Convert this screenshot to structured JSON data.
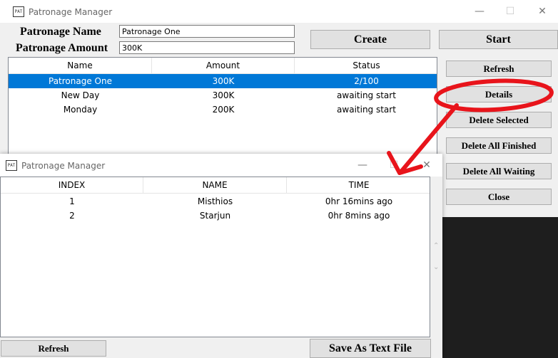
{
  "colors": {
    "accent": "#0078d7",
    "annotation": "#e8141b"
  },
  "main_window": {
    "icon_label": "PAT",
    "title": "Patronage Manager",
    "controls": {
      "minimize": "—",
      "maximize": "☐",
      "close": "✕"
    },
    "form": {
      "name_label": "Patronage Name",
      "name_value": "Patronage One",
      "amount_label": "Patronage Amount",
      "amount_value": "300K"
    },
    "create_label": "Create",
    "start_label": "Start",
    "table": {
      "columns": [
        "Name",
        "Amount",
        "Status"
      ],
      "rows": [
        {
          "name": "Patronage One",
          "amount": "300K",
          "status": "2/100"
        },
        {
          "name": "New Day",
          "amount": "300K",
          "status": "awaiting start"
        },
        {
          "name": "Monday",
          "amount": "200K",
          "status": "awaiting start"
        }
      ]
    },
    "side_buttons": {
      "refresh": "Refresh",
      "details": "Details",
      "delete_selected": "Delete Selected",
      "delete_all_finished": "Delete All Finished",
      "delete_all_waiting": "Delete All Waiting",
      "close": "Close"
    }
  },
  "details_window": {
    "icon_label": "PAT",
    "title": "Patronage Manager",
    "controls": {
      "minimize": "—",
      "maximize": "☐",
      "close": "✕"
    },
    "table": {
      "columns": [
        "INDEX",
        "NAME",
        "TIME"
      ],
      "rows": [
        {
          "index": "1",
          "name": "Misthios",
          "time": "0hr 16mins ago"
        },
        {
          "index": "2",
          "name": "Starjun",
          "time": "0hr 8mins ago"
        }
      ]
    },
    "scroll_up": "⌃",
    "scroll_down": "⌄",
    "refresh_label": "Refresh",
    "save_label": "Save As Text File"
  }
}
